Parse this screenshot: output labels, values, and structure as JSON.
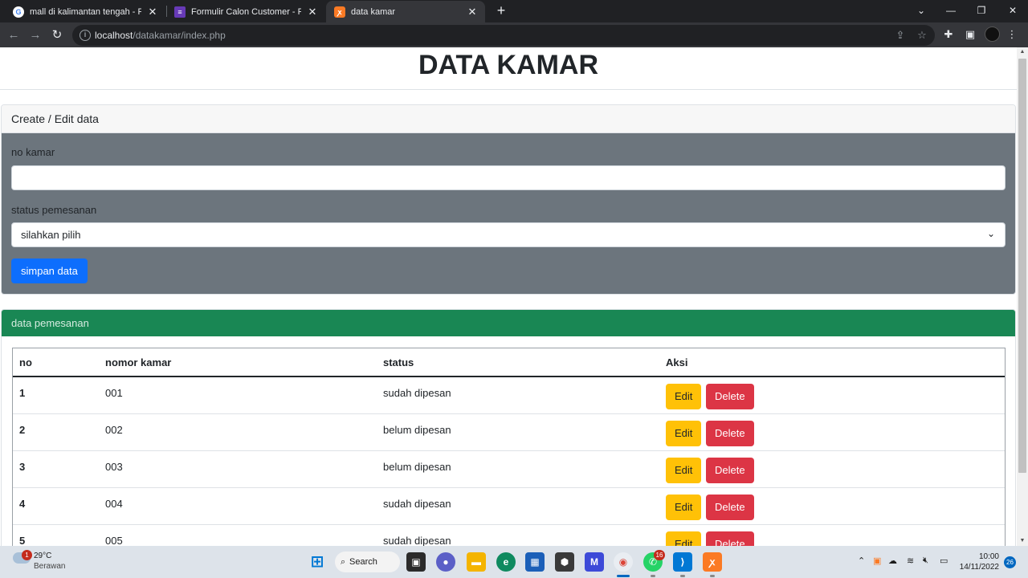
{
  "browser": {
    "tabs": [
      {
        "title": "mall di kalimantan tengah - Pene",
        "icon": "google-icon"
      },
      {
        "title": "Formulir Calon Customer - Flight",
        "icon": "forms-icon"
      },
      {
        "title": "data kamar",
        "icon": "xampp-icon"
      }
    ],
    "url_host": "localhost",
    "url_path": "/datakamar/index.php"
  },
  "page": {
    "title": "DATA KAMAR",
    "form_card": {
      "header": "Create / Edit data",
      "no_kamar_label": "no kamar",
      "no_kamar_value": "",
      "status_label": "status pemesanan",
      "status_selected": "silahkan pilih",
      "submit_label": "simpan data"
    },
    "table_card": {
      "header": "data pemesanan",
      "columns": [
        "no",
        "nomor kamar",
        "status",
        "Aksi"
      ],
      "rows": [
        {
          "no": "1",
          "nomor_kamar": "001",
          "status": "sudah dipesan"
        },
        {
          "no": "2",
          "nomor_kamar": "002",
          "status": "belum dipesan"
        },
        {
          "no": "3",
          "nomor_kamar": "003",
          "status": "belum dipesan"
        },
        {
          "no": "4",
          "nomor_kamar": "004",
          "status": "sudah dipesan"
        },
        {
          "no": "5",
          "nomor_kamar": "005",
          "status": "sudah dipesan"
        }
      ],
      "edit_label": "Edit",
      "delete_label": "Delete"
    }
  },
  "taskbar": {
    "weather_temp": "29°C",
    "weather_desc": "Berawan",
    "weather_badge": "1",
    "search_label": "Search",
    "whatsapp_badge": "16",
    "time": "10:00",
    "date": "14/11/2022",
    "notification_count": "26"
  },
  "colors": {
    "primary": "#0d6efd",
    "success": "#198754",
    "secondary": "#6c757d",
    "warning": "#ffc107",
    "danger": "#dc3545"
  }
}
